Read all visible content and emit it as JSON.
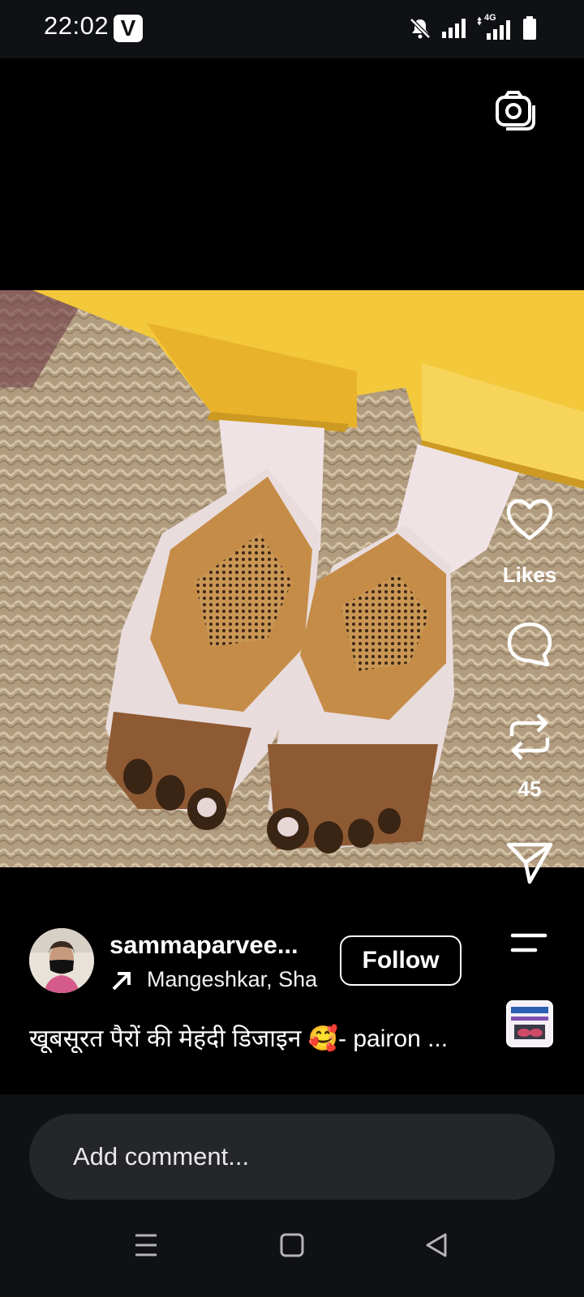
{
  "status_bar": {
    "time": "22:02",
    "app_badge": "V",
    "network_label": "4G",
    "icons": [
      "bell-off-icon",
      "signal-icon",
      "signal-4g-icon",
      "battery-icon"
    ]
  },
  "media": {
    "camera_icon": "camera-icon",
    "photo_description_icon": "mehndi-feet-photo"
  },
  "actions": {
    "like_label": "Likes",
    "comment_icon": "comment-icon",
    "repost_count": "45",
    "share_icon": "share-icon",
    "menu_icon": "menu-icon"
  },
  "post": {
    "username": "sammaparvee...",
    "location": "Mangeshkar, Sha",
    "follow_label": "Follow",
    "caption": "खूबसूरत पैरों की मेहंदी डिजाइन 🥰- pairon ..."
  },
  "comment": {
    "placeholder": "Add comment..."
  },
  "navbar": {
    "icons": [
      "recents-icon",
      "home-icon",
      "back-icon"
    ]
  }
}
